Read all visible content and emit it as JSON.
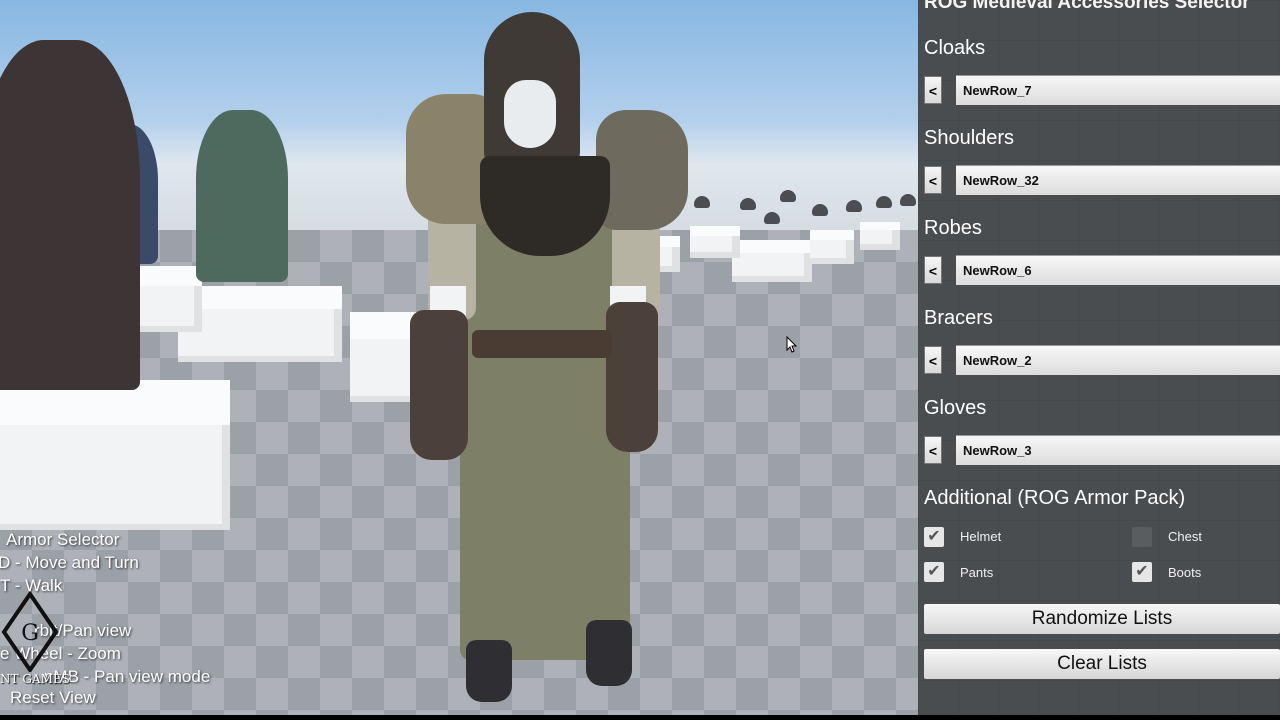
{
  "panel": {
    "title": "ROG Medieval Accessories Selector",
    "sections": [
      {
        "label": "Cloaks",
        "value": "NewRow_7",
        "prev": "<"
      },
      {
        "label": "Shoulders",
        "value": "NewRow_32",
        "prev": "<"
      },
      {
        "label": "Robes",
        "value": "NewRow_6",
        "prev": "<"
      },
      {
        "label": "Bracers",
        "value": "NewRow_2",
        "prev": "<"
      },
      {
        "label": "Gloves",
        "value": "NewRow_3",
        "prev": "<"
      }
    ],
    "additional_label": "Additional (ROG Armor Pack)",
    "checkboxes": [
      {
        "label": "Helmet",
        "checked": true
      },
      {
        "label": "Chest",
        "checked": false
      },
      {
        "label": "Pants",
        "checked": true
      },
      {
        "label": "Boots",
        "checked": true
      }
    ],
    "randomize_label": "Randomize Lists",
    "clear_label": "Clear Lists"
  },
  "help": {
    "lines": [
      "Armor Selector",
      "D - Move and Turn",
      "T - Walk",
      "rbit/Pan view",
      "e Wheel - Zoom",
      "nMB - Pan view mode",
      "Reset View"
    ]
  },
  "logo": {
    "text": "NT GAMES"
  },
  "icons": {
    "cursor": "mouse-cursor-icon",
    "check": "checkmark-icon",
    "logo": "company-logo-icon"
  }
}
